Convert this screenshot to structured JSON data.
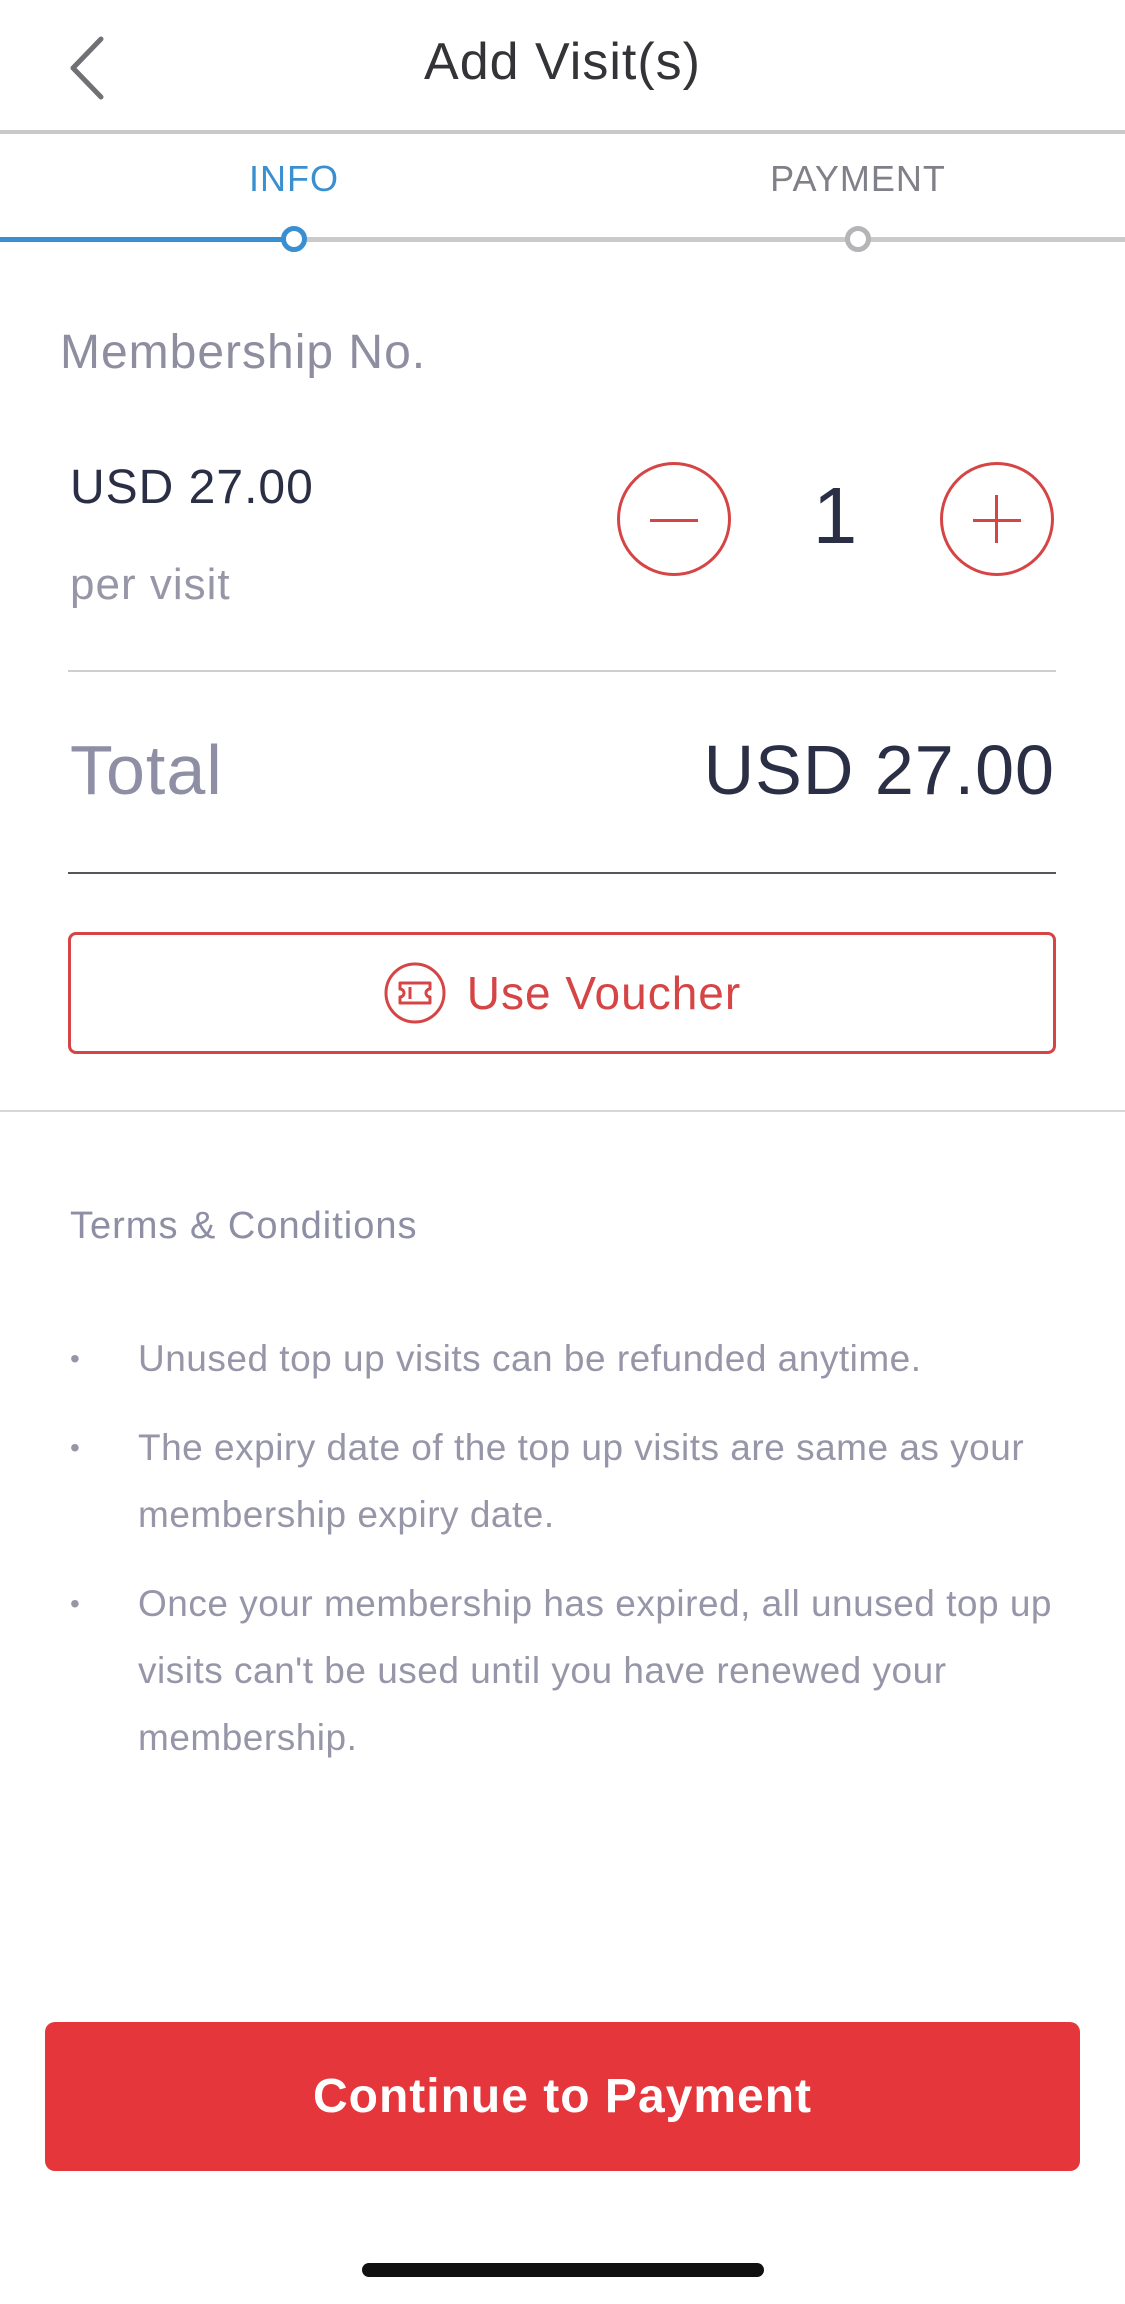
{
  "header": {
    "title": "Add Visit(s)",
    "back_icon": "chevron-left-icon"
  },
  "steps": {
    "items": [
      {
        "label": "INFO",
        "active": true
      },
      {
        "label": "PAYMENT",
        "active": false
      }
    ],
    "active_color": "#3a8fd0",
    "inactive_color": "#808088"
  },
  "membership": {
    "label": "Membership No.",
    "value": ""
  },
  "visit": {
    "price": "USD 27.00",
    "unit": "per visit",
    "quantity": "1",
    "decrement_icon": "minus-circle-icon",
    "increment_icon": "plus-circle-icon"
  },
  "total": {
    "label": "Total",
    "value": "USD 27.00"
  },
  "voucher": {
    "label": "Use Voucher",
    "icon": "ticket-icon"
  },
  "terms": {
    "title": "Terms & Conditions",
    "bullet": "•",
    "items": [
      "Unused top up visits can be refunded anytime.",
      "The expiry date of the top up visits are same as your membership expiry date.",
      "Once your membership has expired, all unused top up visits can't be used until you have renewed your membership."
    ]
  },
  "cta": {
    "label": "Continue to Payment",
    "color": "#e5363b"
  },
  "colors": {
    "accent_red": "#d64545",
    "primary_text": "#2b2f45",
    "muted_text": "#8e8ea4"
  }
}
